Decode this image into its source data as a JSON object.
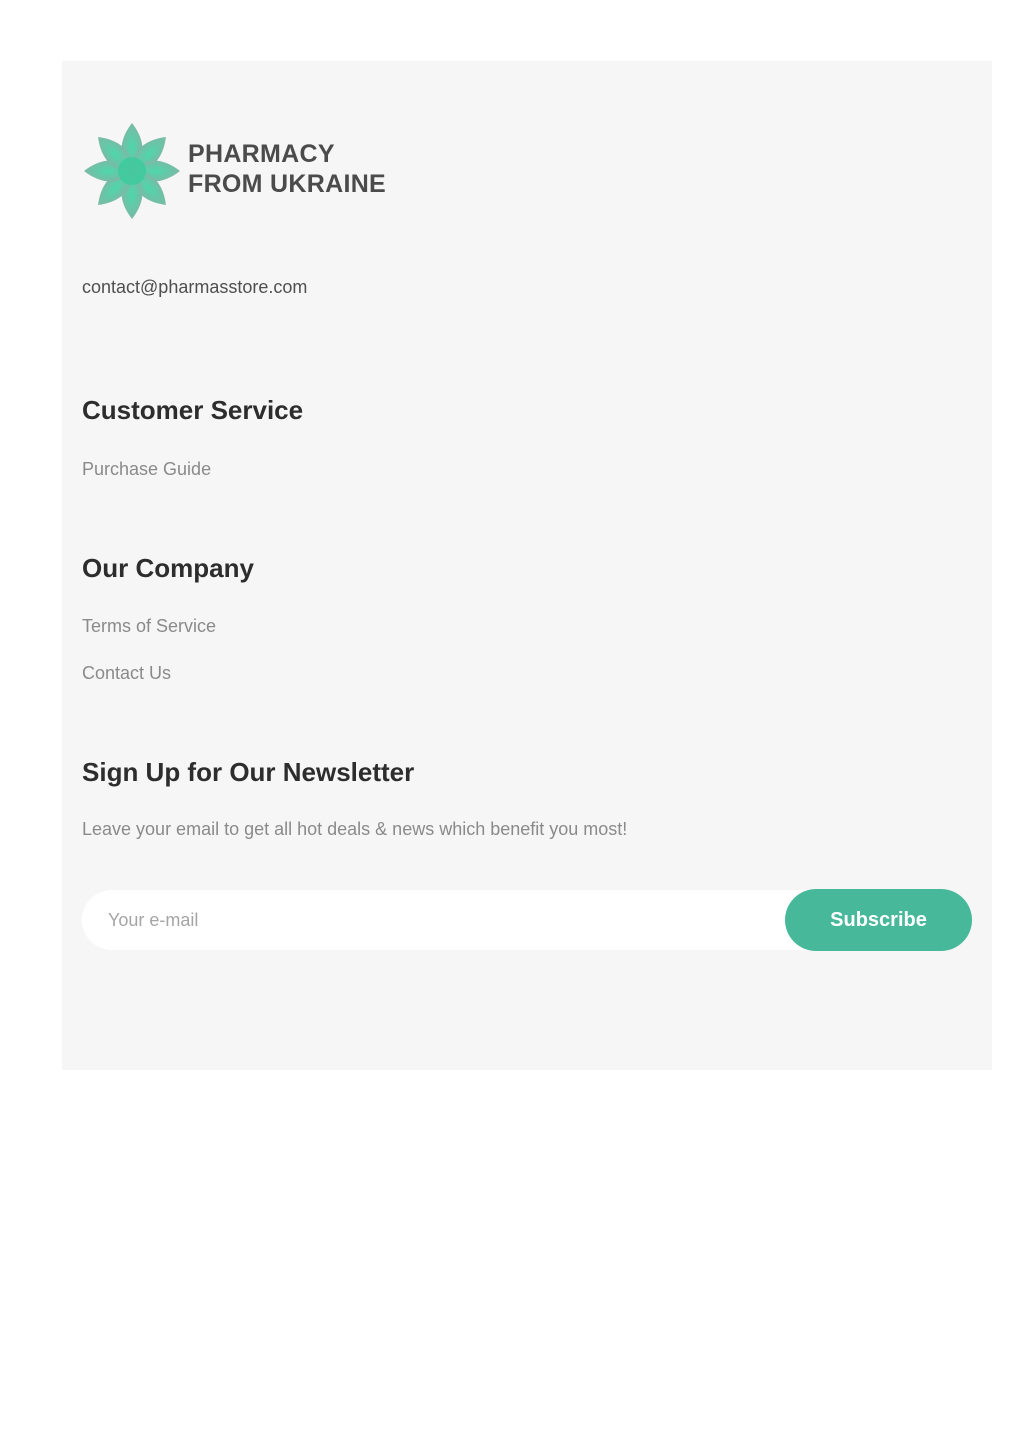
{
  "brand": {
    "name_line1": "PHARMACY",
    "name_line2": "FROM UKRAINE",
    "logo_icon": "green-flower-icon",
    "accent_color": "#48b89a"
  },
  "contact": {
    "email": "contact@pharmasstore.com"
  },
  "customer_service": {
    "heading": "Customer Service",
    "links": [
      "Purchase Guide"
    ]
  },
  "our_company": {
    "heading": "Our Company",
    "links": [
      "Terms of Service",
      "Contact Us"
    ]
  },
  "newsletter": {
    "heading": "Sign Up for Our Newsletter",
    "description": "Leave your email to get all hot deals & news which benefit you most!",
    "input_placeholder": "Your e-mail",
    "input_value": "",
    "button_label": "Subscribe"
  }
}
